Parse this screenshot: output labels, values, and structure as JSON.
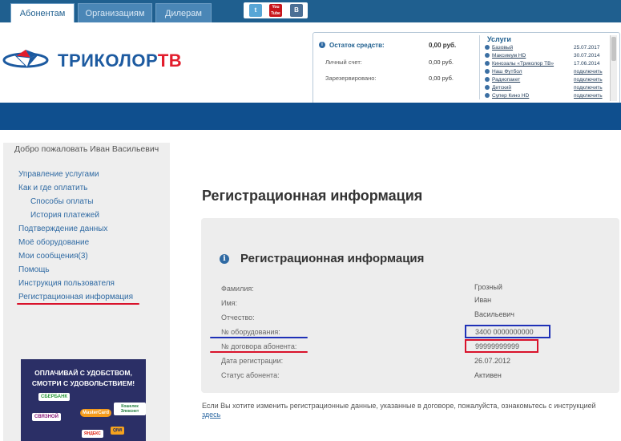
{
  "top_tabs": [
    {
      "label": "Абонентам",
      "active": true
    },
    {
      "label": "Организациям",
      "active": false
    },
    {
      "label": "Дилерам",
      "active": false
    }
  ],
  "social": [
    {
      "icon": "twitter-icon",
      "glyph": "t",
      "color": "#58a6d6"
    },
    {
      "icon": "youtube-icon",
      "glyph": "You Tube",
      "color": "#c8151b"
    },
    {
      "icon": "vk-icon",
      "glyph": "B",
      "color": "#4b6f95"
    }
  ],
  "logo": {
    "text": "ТРИКОЛОР",
    "suffix": "ТВ"
  },
  "balance": {
    "title": "Остаток средств:",
    "title_value": "0,00 руб.",
    "rows": [
      {
        "label": "Личный счет:",
        "value": "0,00 руб."
      },
      {
        "label": "Зарезервировано:",
        "value": "0,00 руб."
      }
    ]
  },
  "services": {
    "title": "Услуги",
    "items": [
      {
        "name": "Базовый",
        "date": "25.07.2017"
      },
      {
        "name": "Максимум HD",
        "date": "30.07.2014"
      },
      {
        "name": "Кинозалы «Триколор ТВ»",
        "date": "17.06.2014"
      },
      {
        "name": "Наш Футбол",
        "date": "подключить"
      },
      {
        "name": "Радиопакет",
        "date": "подключить"
      },
      {
        "name": "Детский",
        "date": "подключить"
      },
      {
        "name": "Супер Кино HD",
        "date": "подключить"
      }
    ]
  },
  "sidebar": {
    "welcome": "Добро пожаловать Иван Васильевич",
    "menu": [
      {
        "label": "Управление услугами",
        "indent": false
      },
      {
        "label": "Как и где оплатить",
        "indent": false
      },
      {
        "label": "Способы оплаты",
        "indent": true
      },
      {
        "label": "История платежей",
        "indent": true
      },
      {
        "label": "Подтверждение данных",
        "indent": false
      },
      {
        "label": "Моё оборудование",
        "indent": false
      },
      {
        "label": "Мои сообщения(3)",
        "indent": false
      },
      {
        "label": "Помощь",
        "indent": false
      },
      {
        "label": "Инструкция пользователя",
        "indent": false
      },
      {
        "label": "Регистрационная информация",
        "indent": false
      }
    ]
  },
  "promo": {
    "line1": "ОПЛАЧИВАЙ С УДОБСТВОМ,",
    "line2": "СМОТРИ С УДОВОЛЬСТВИЕМ!",
    "brands": [
      "СБЕРБАНК",
      "СВЯЗНОЙ",
      "MasterCard",
      "Кошелек Элекснет",
      "ЯНДЕКС",
      "QIWI"
    ]
  },
  "main": {
    "page_title": "Регистрационная информация",
    "panel_title": "Регистрационная информация",
    "fields": [
      {
        "label": "Фамилия:",
        "value": "Грозный"
      },
      {
        "label": "Имя:",
        "value": "Иван"
      },
      {
        "label": "Отчество:",
        "value": "Васильевич"
      },
      {
        "label": "№ оборудования:",
        "value": "3400 0000000000"
      },
      {
        "label": "№ договора абонента:",
        "value": "99999999999"
      },
      {
        "label": "Дата регистрации:",
        "value": "26.07.2012"
      },
      {
        "label": "Статус абонента:",
        "value": "Активен"
      }
    ],
    "note": "Если Вы хотите изменить регистрационные данные, указанные в договоре, пожалуйста, ознакомьтесь с инструкцией",
    "note_link": "здесь"
  },
  "colors": {
    "accent": "#1f5f8f",
    "brand_blue": "#0f4f8e",
    "highlight_red": "#d9122b",
    "highlight_blue": "#1f31b7"
  }
}
